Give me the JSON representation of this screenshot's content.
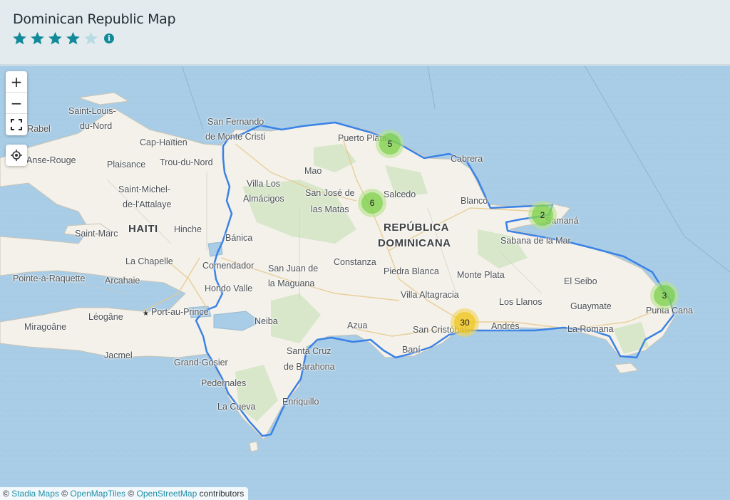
{
  "header": {
    "title": "Dominican Republic Map",
    "rating": 4,
    "rating_max": 5,
    "star_color": "#138a9a",
    "star_empty_color": "#b7dce3",
    "info_icon": "info-icon"
  },
  "map": {
    "colors": {
      "water": "#a9cde6",
      "land": "#f4f1ea",
      "route": "#3b82e6"
    },
    "controls": {
      "zoom_in": "+",
      "zoom_out": "−",
      "fullscreen_icon": "fullscreen-icon",
      "locate_icon": "locate-icon"
    },
    "country_labels": {
      "haiti": "HAITI",
      "dr_line1": "REPÚBLICA",
      "dr_line2": "DOMINICANA"
    },
    "places": {
      "saint_louis": "Saint-Louis-",
      "du_nord": "du-Nord",
      "port_de_paix": "-Rabel",
      "cap_haitien": "Cap-Haïtien",
      "anse_rouge": "Anse-Rouge",
      "plaisance": "Plaisance",
      "trou_du_nord": "Trou-du-Nord",
      "saint_michel": "Saint-Michel-",
      "attalaye": "de-l'Attalaye",
      "saint_marc": "Saint-Marc",
      "hinche": "Hinche",
      "la_chapelle": "La Chapelle",
      "pointe_raquette": "Pointe-à-Raquette",
      "arcahaie": "Arcahaie",
      "leogane": "Léogâne",
      "port_au_prince": "Port-au-Prince",
      "miragoane": "Miragoâne",
      "jacmel": "Jacmel",
      "grand_goser": "Grand-Gosier",
      "san_fernando": "San Fernando",
      "monte_cristi": "de Monte Cristi",
      "puerto_plata": "Puerto Plata",
      "cabrera": "Cabrera",
      "mao": "Mao",
      "villa_los": "Villa Los",
      "almacigos": "Almácigos",
      "san_jose": "San José de",
      "las_matas_santiago": "las Matas",
      "salcedo": "Salcedo",
      "blanco": "Blanco",
      "samana": "Samaná",
      "banica": "Bánica",
      "sabana_mar": "Sabana de la Mar",
      "comendador": "Comendador",
      "san_juan": "San Juan de",
      "maguana": "la Maguana",
      "constanza": "Constanza",
      "piedra_blanca": "Piedra Blanca",
      "monte_plata": "Monte Plata",
      "el_seibo": "El Seibo",
      "hondo_valle": "Hondo Valle",
      "villa_altagracia": "Villa Altagracia",
      "los_llanos": "Los Llanos",
      "guaymate": "Guaymate",
      "punta_cana": "Punta Cana",
      "neiba": "Neiba",
      "azua": "Azua",
      "san_cristobal": "San Cristóbal",
      "andres": "Andrés",
      "la_romana": "La Romana",
      "bani": "Baní",
      "santa_cruz": "Santa Cruz",
      "barahona": "de Barahona",
      "pedernales": "Pedernales",
      "la_cueva": "La Cueva",
      "enriquillo": "Enriquillo"
    },
    "clusters": [
      {
        "name": "puerto-plata-cluster",
        "count": "5",
        "size": "small"
      },
      {
        "name": "santiago-cluster",
        "count": "6",
        "size": "small"
      },
      {
        "name": "samana-cluster",
        "count": "2",
        "size": "small"
      },
      {
        "name": "punta-cana-cluster",
        "count": "3",
        "size": "small"
      },
      {
        "name": "santo-domingo-cluster",
        "count": "30",
        "size": "medium"
      }
    ]
  },
  "attribution": {
    "prefix": "©",
    "stadia": "Stadia Maps",
    "sep1": "©",
    "openmaptiles": "OpenMapTiles",
    "sep2": "©",
    "osm": "OpenStreetMap",
    "suffix": "contributors"
  }
}
